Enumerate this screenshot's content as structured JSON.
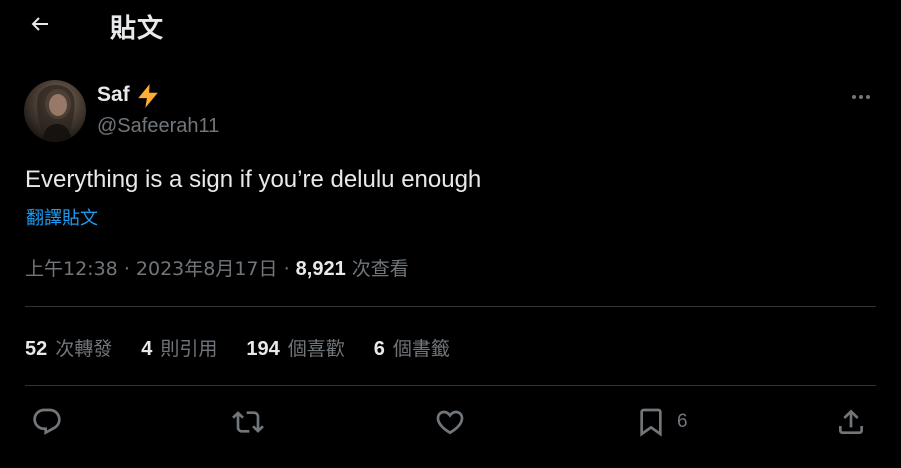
{
  "header": {
    "title": "貼文",
    "back_icon": "arrow-left-icon"
  },
  "author": {
    "name": "Saf",
    "emoji": "⚡",
    "handle": "@Safeerah11"
  },
  "tweet": {
    "text": "Everything is a sign if you’re delulu enough",
    "translate_label": "翻譯貼文",
    "time": "上午12:38",
    "date": "2023年8月17日",
    "separator": "·",
    "views_count": "8,921",
    "views_label": "次查看"
  },
  "stats": {
    "retweets": {
      "count": "52",
      "label": "次轉發"
    },
    "quotes": {
      "count": "4",
      "label": "則引用"
    },
    "likes": {
      "count": "194",
      "label": "個喜歡"
    },
    "bookmarks": {
      "count": "6",
      "label": "個書籤"
    }
  },
  "actions": {
    "bookmark_count": "6"
  },
  "colors": {
    "background": "#000000",
    "text_primary": "#e7e9ea",
    "text_secondary": "#71767b",
    "link": "#1d9bf0",
    "divider": "#2f3336"
  }
}
